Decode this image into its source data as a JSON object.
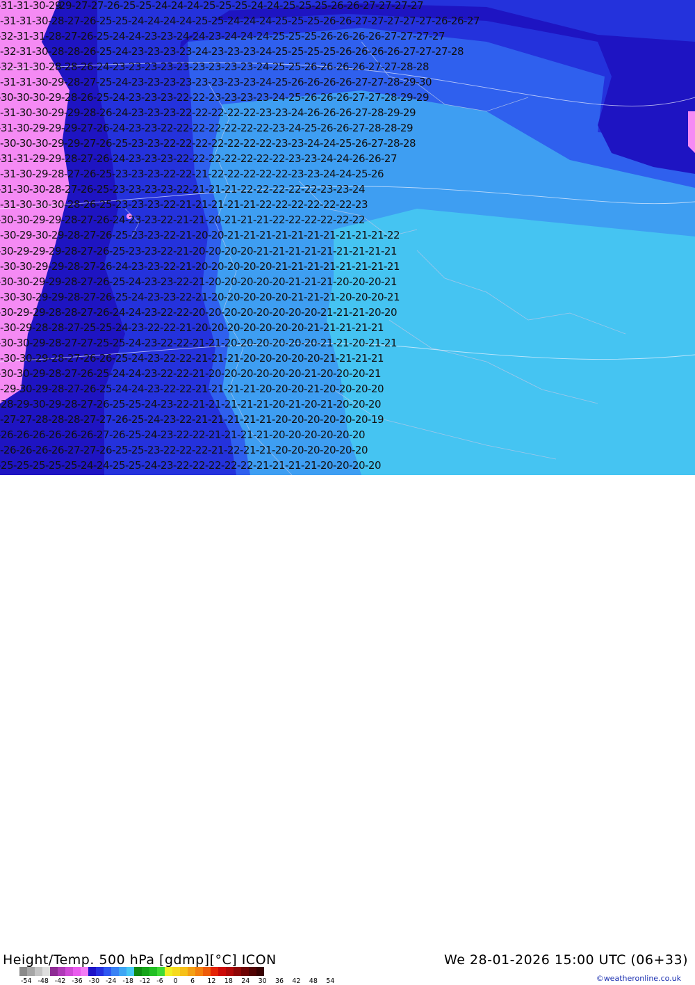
{
  "header": {
    "title": "Height/Temp. 500 hPa [gdmp][°C] ICON",
    "valid_time": "We 28-01-2026 15:00 UTC (06+33)",
    "credit": "©weatheronline.co.uk"
  },
  "legend": {
    "ticks": [
      "-54",
      "-48",
      "-42",
      "-36",
      "-30",
      "-24",
      "-18",
      "-12",
      "-6",
      "0",
      "6",
      "12",
      "18",
      "24",
      "30",
      "36",
      "42",
      "48",
      "54"
    ],
    "colors": [
      "#8a8a8a",
      "#a6a6a6",
      "#c4c4c4",
      "#dedede",
      "#8e2c94",
      "#b03ab8",
      "#d04ad6",
      "#ea5cee",
      "#f37cf6",
      "#1d13c8",
      "#2530e0",
      "#2f58f2",
      "#3a82f4",
      "#3ea6f4",
      "#46c8f4",
      "#0e8a12",
      "#16a41a",
      "#22c024",
      "#40da34",
      "#f0f024",
      "#f6da1e",
      "#f6c018",
      "#f4a014",
      "#f4800e",
      "#ee5c0a",
      "#e42406",
      "#cc0a08",
      "#b00808",
      "#8e0606",
      "#6e0404",
      "#520404",
      "#380202"
    ]
  },
  "map": {
    "colors": {
      "pink": "#f58af4",
      "dark_blue": "#1e14c2",
      "blue": "#2432dc",
      "mid_blue": "#2f60ee",
      "light_blue": "#3e9ef2",
      "sky": "#45c4f2",
      "lines": "#101010"
    },
    "isotherm_labels": [
      {
        "text": "-31-31-30-29",
        "row": 0,
        "col": 0
      },
      {
        "text": "-29-27-27-26-25-25-24-24-24-25-25-25-24-24-25-25-25-26-26-27-27-27-27",
        "row": 0,
        "col": 1
      },
      {
        "text": "-31-31-30-28-27-26-25-25-24-24-24-24-25-25-24-24-24-25-25-25-26-26-27-27-27-27-27-26-26-27",
        "row": 1,
        "col": 0
      },
      {
        "text": "-32-31-31-28-27-26-25-24-24-23-23-24-24-23-24-24-24-25-25-25-26-26-26-26-27-27-27-27",
        "row": 2,
        "col": 0
      },
      {
        "text": "-32-31-30-28-28-26-25-24-23-23-23-23-24-23-23-23-24-25-25-25-25-26-26-26-26-27-27-27-28",
        "row": 3,
        "col": 0
      },
      {
        "text": "-32-31-30-28-28-26-24-23-23-23-23-23-23-23-23-23-24-25-25-26-26-26-26-27-27-28-28",
        "row": 4,
        "col": 0
      },
      {
        "text": "-31-31-30-29-28-27-25-24-23-23-23-23-23-23-23-23-24-25-26-26-26-26-27-27-28-29-30",
        "row": 5,
        "col": 0
      },
      {
        "text": "-30-30-30-29-28-26-25-24-23-23-23-22-22-23-23-23-23-24-25-26-26-26-27-27-28-29-29",
        "row": 6,
        "col": 0
      },
      {
        "text": "-31-30-30-29-29-28-26-24-23-23-23-22-22-22-22-22-23-23-24-26-26-26-27-28-29-29",
        "row": 7,
        "col": 0
      },
      {
        "text": "-31-30-29-29-29-27-26-24-23-23-22-22-22-22-22-22-22-23-24-25-26-26-27-28-28-29",
        "row": 8,
        "col": 0
      },
      {
        "text": "-30-30-30-29-29-27-26-25-23-23-22-22-22-22-22-22-22-23-23-24-24-25-26-27-28-28",
        "row": 9,
        "col": 0
      },
      {
        "text": "-31-31-29-29-28-27-26-24-23-23-23-22-22-22-22-22-22-22-23-23-24-24-26-26-27",
        "row": 10,
        "col": 0
      },
      {
        "text": "-31-30-29-28-27-26-25-23-23-23-22-22-21-22-22-22-22-22-23-23-24-24-25-26",
        "row": 11,
        "col": 0
      },
      {
        "text": "-31-30-30-28-27-26-25-23-23-23-23-22-21-21-21-22-22-22-22-22-23-23-24",
        "row": 12,
        "col": 0
      },
      {
        "text": "-31-30-30-30-28-26-25-23-23-23-22-21-21-21-21-21-22-22-22-22-22-22-23",
        "row": 13,
        "col": 0
      },
      {
        "text": "-30-30-29-29-28-27-26-24-23-23-22-21-21-20-21-21-21-22-22-22-22-22-22",
        "row": 14,
        "col": 0
      },
      {
        "text": "-30-29-30-29-28-27-26-25-23-23-22-21-20-20-21-21-21-21-21-21-21-21-21-21-22",
        "row": 15,
        "col": 0
      },
      {
        "text": "-30-29-29-29-28-27-26-25-23-23-22-21-20-20-20-20-21-21-21-21-21-21-21-21-21",
        "row": 16,
        "col": 0
      },
      {
        "text": "-30-30-29-29-28-27-26-24-23-23-22-21-20-20-20-20-20-21-21-21-21-21-21-21-21",
        "row": 17,
        "col": 0
      },
      {
        "text": "-30-30-29-29-28-27-26-25-24-23-23-22-21-20-20-20-20-20-21-21-21-20-20-20-21",
        "row": 18,
        "col": 0
      },
      {
        "text": "-30-30-29-29-28-27-26-25-24-23-23-22-21-20-20-20-20-20-21-21-21-20-20-20-21",
        "row": 19,
        "col": 0
      },
      {
        "text": "-30-29-29-28-28-27-26-24-24-23-22-22-20-20-20-20-20-20-20-20-21-21-21-20-20",
        "row": 20,
        "col": 0
      },
      {
        "text": "-30-29-28-28-27-25-25-24-23-22-22-21-20-20-20-20-20-20-20-21-21-21-21-21",
        "row": 21,
        "col": 0
      },
      {
        "text": "-30-30-29-28-27-27-25-25-24-23-22-22-21-21-20-20-20-20-20-20-21-21-20-21-21",
        "row": 22,
        "col": 0
      },
      {
        "text": "-30-30-29-28-27-26-26-25-24-23-22-22-21-21-21-20-20-20-20-20-21-21-21-21",
        "row": 23,
        "col": 0
      },
      {
        "text": "-30-30-29-28-27-26-25-24-24-23-22-22-21-20-20-20-20-20-20-21-20-20-20-21",
        "row": 24,
        "col": 0
      },
      {
        "text": "-29-30-29-28-27-26-25-24-24-23-22-22-21-21-21-21-20-20-20-21-20-20-20-20",
        "row": 25,
        "col": 0
      },
      {
        "text": "-28-29-30-29-28-27-26-25-25-24-23-22-21-21-21-21-21-20-21-20-21-20-20-20",
        "row": 26,
        "col": 0
      },
      {
        "text": "-27-27-28-28-28-27-27-26-25-24-23-22-21-21-21-21-21-20-20-20-20-20-20-19",
        "row": 27,
        "col": 0
      },
      {
        "text": "-26-26-26-26-26-26-27-26-25-24-23-22-22-21-21-21-21-20-20-20-20-20-20",
        "row": 28,
        "col": 0
      },
      {
        "text": "-26-26-26-26-27-27-26-25-25-23-22-22-22-21-22-21-21-20-20-20-20-20-20",
        "row": 29,
        "col": 0
      },
      {
        "text": "-25-25-25-25-25-24-24-25-25-24-23-22-22-22-22-22-21-21-21-21-20-20-20-20",
        "row": 30,
        "col": 0
      }
    ]
  }
}
